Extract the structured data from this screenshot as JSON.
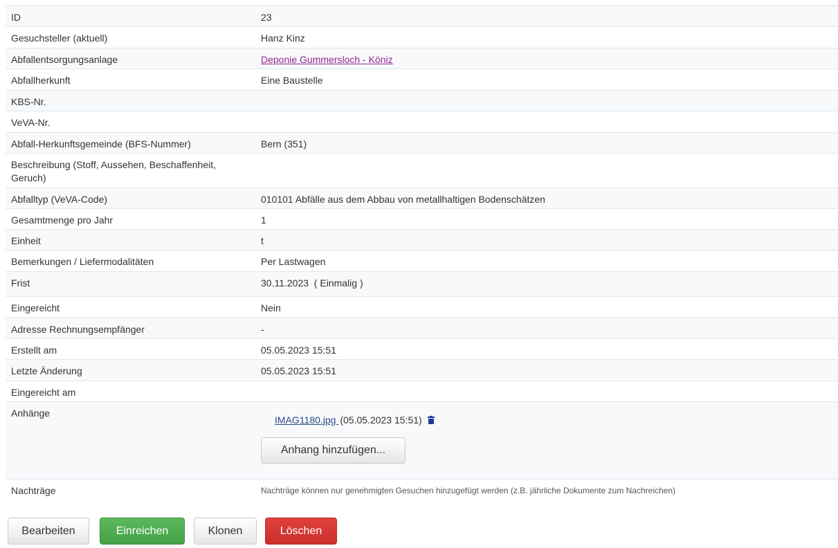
{
  "rows": [
    {
      "label": "ID",
      "value": "23"
    },
    {
      "label": "Gesuchsteller (aktuell)",
      "value": "Hanz Kinz"
    },
    {
      "label": "Abfallentsorgungsanlage",
      "value": "Deponie Gummersloch - Köniz"
    },
    {
      "label": "Abfallherkunft",
      "value": "Eine Baustelle"
    },
    {
      "label": "KBS-Nr.",
      "value": ""
    },
    {
      "label": "VeVA-Nr.",
      "value": ""
    },
    {
      "label": "Abfall-Herkunftsgemeinde  (BFS-Nummer)",
      "value": "Bern (351)"
    },
    {
      "label": "Beschreibung (Stoff, Aussehen, Beschaffenheit, Geruch)",
      "value": ""
    },
    {
      "label": "Abfalltyp (VeVA-Code)",
      "value": "010101 Abfälle aus dem Abbau von metallhaltigen Bodenschätzen"
    },
    {
      "label": "Gesamtmenge pro Jahr",
      "value": "1"
    },
    {
      "label": "Einheit",
      "value": "t"
    },
    {
      "label": "Bemerkungen / Liefermodalitäten",
      "value": "Per Lastwagen"
    },
    {
      "label": "Frist",
      "value": "30.11.2023  ( Einmalig )"
    },
    {
      "label": "Eingereicht",
      "value": "Nein"
    },
    {
      "label": "Adresse Rechnungsempfänger",
      "value": "-"
    },
    {
      "label": "Erstellt am",
      "value": "05.05.2023 15:51"
    },
    {
      "label": "Letzte Änderung",
      "value": "05.05.2023 15:51"
    },
    {
      "label": "Eingereicht am",
      "value": ""
    },
    {
      "label": "Anhänge"
    },
    {
      "label": "Nachträge",
      "value": "Nachträge können nur genehmigten Gesuchen hinzugefügt werden (z.B. jährliche Dokumente zum Nachreichen)"
    }
  ],
  "attachment": {
    "filename": "IMAG1180.jpg ",
    "date": "(05.05.2023 15:51)",
    "delete_icon": "trash-icon",
    "add_button_label": "Anhang hinzufügen..."
  },
  "actions": {
    "edit": "Bearbeiten",
    "submit": "Einreichen",
    "clone": "Klonen",
    "delete": "Löschen"
  },
  "colors": {
    "link_visited": "#93278f",
    "link": "#2a4a88",
    "submit_green": "#5cb85c",
    "delete_red": "#d9534f"
  }
}
